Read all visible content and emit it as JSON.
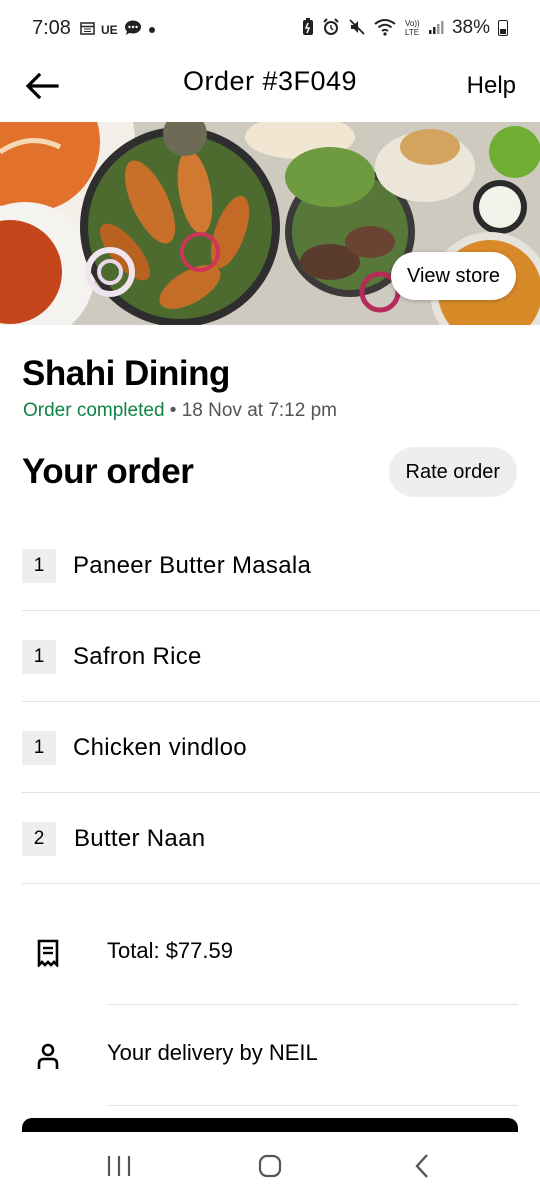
{
  "status_bar": {
    "time": "7:08",
    "left_icons": [
      "calendar-icon",
      "UE",
      "chat-bubble-icon",
      "dot-icon"
    ],
    "right_icons": [
      "battery-saver-icon",
      "alarm-icon",
      "mute-icon",
      "wifi-icon",
      "volte-icon",
      "signal-icon"
    ],
    "battery": "38%"
  },
  "header": {
    "title": "Order #3F049",
    "help_label": "Help",
    "back_icon": "arrow-left-icon"
  },
  "hero": {
    "view_store_label": "View store"
  },
  "store": {
    "name": "Shahi Dining",
    "status": "Order completed",
    "separator": " • ",
    "date": "18 Nov at 7:12 pm"
  },
  "order": {
    "title": "Your order",
    "rate_label": "Rate order",
    "items": [
      {
        "qty": "1",
        "name": "Paneer Butter Masala"
      },
      {
        "qty": "1",
        "name": "Safron Rice"
      },
      {
        "qty": "1",
        "name": "Chicken vindloo"
      },
      {
        "qty": "2",
        "name": "Butter Naan"
      }
    ]
  },
  "summary": {
    "total": "Total: $77.59",
    "total_icon": "receipt-icon",
    "delivery": "Your delivery by NEIL",
    "delivery_icon": "person-icon"
  },
  "nav": {
    "recents_icon": "recents-icon",
    "home_icon": "home-icon",
    "back_icon": "back-chevron-icon"
  },
  "colors": {
    "accent_green": "#0e8345",
    "chip_bg": "#eeeeee",
    "divider": "#e2e2e2"
  }
}
